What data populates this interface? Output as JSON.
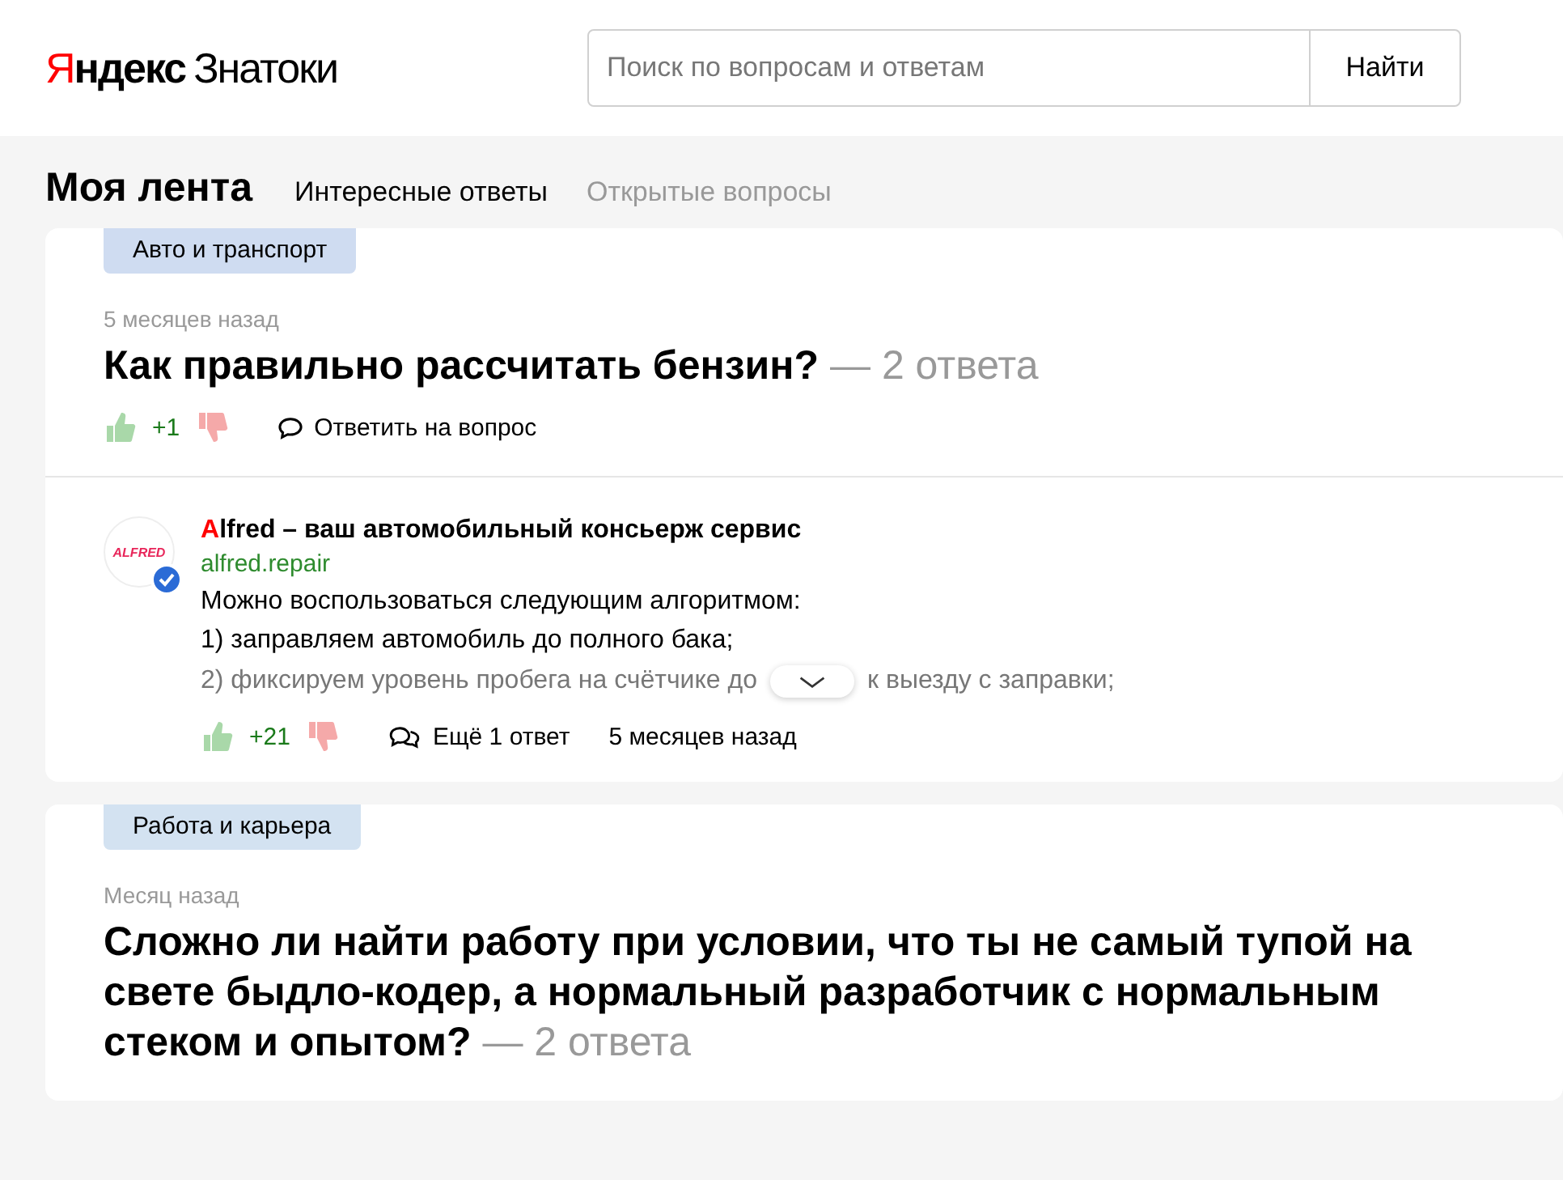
{
  "header": {
    "logo": {
      "accent": "Я",
      "brand": "ндекс",
      "product": "Знатоки"
    },
    "search": {
      "placeholder": "Поиск по вопросам и ответам"
    },
    "search_button": "Найти"
  },
  "feed": {
    "title": "Моя лента",
    "tabs": [
      {
        "label": "Интересные ответы",
        "selected": true
      },
      {
        "label": "Открытые вопросы",
        "selected": false
      }
    ]
  },
  "questions": [
    {
      "category": "Авто и транспорт",
      "color": "#cfdcf1",
      "time": "5 месяцев назад",
      "title": "Как правильно рассчитать бензин?",
      "answers": "— 2 ответа",
      "votes": "+1",
      "action": "Ответить на вопрос",
      "answer": {
        "author_accent": "A",
        "author": "lfred – ваш автомобильный консьерж сервис",
        "verified": true,
        "avatar_text": "ALFRED",
        "site": "alfred.repair",
        "lines": [
          "Можно воспользоваться следующим алгоритмом:",
          "1) заправляем автомобиль до полного бака;"
        ],
        "cut_line_start": "2) фиксируем уровень пробега на счётчике до",
        "cut_line_end": "к выезду с заправки;",
        "votes": "+21",
        "more": "Ещё 1 ответ",
        "time": "5 месяцев назад"
      }
    },
    {
      "category": "Работа и карьера",
      "color": "#d3e2f1",
      "time": "Месяц назад",
      "title": "Сложно ли найти работу при условии, что ты не самый тупой на свете быдло-кодер, а нормальный разработчик с нормальным стеком и опытом?",
      "answers": "— 2 ответа"
    }
  ]
}
